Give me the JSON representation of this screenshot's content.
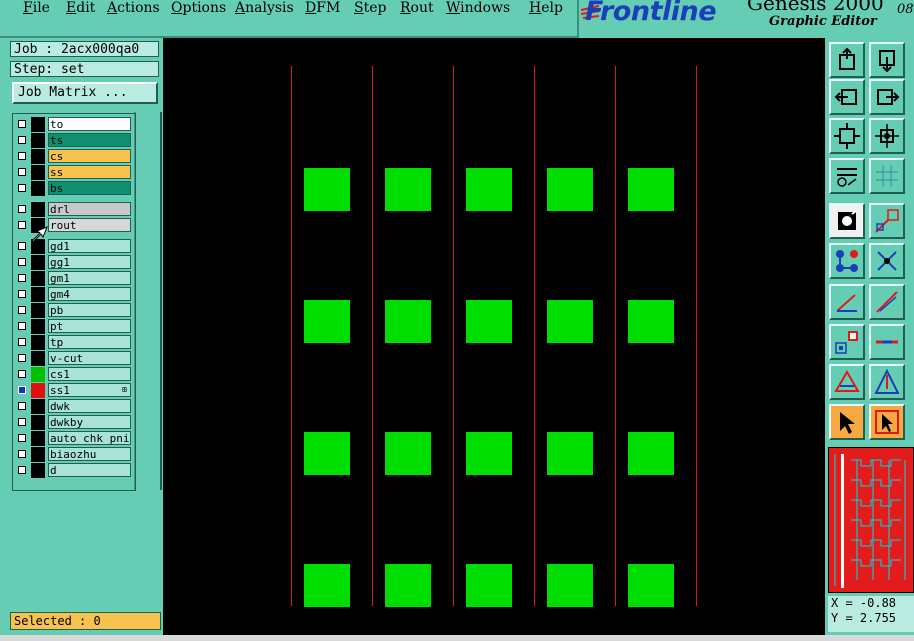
{
  "menubar": {
    "items": [
      "File",
      "Edit",
      "Actions",
      "Options",
      "Analysis",
      "DFM",
      "Step",
      "Rout",
      "Windows",
      "Help"
    ]
  },
  "brand": {
    "logo": "Frontline",
    "product": "Genesis 2000",
    "subtitle": "Graphic Editor",
    "extra": "08"
  },
  "job": {
    "job_label": "Job : 2acx000qa0",
    "step_label": "Step: set",
    "matrix_button": "Job Matrix ..."
  },
  "layers": [
    {
      "name": "to",
      "bg": "#ffffff",
      "swatch": "#000000"
    },
    {
      "name": "ts",
      "bg": "#0f8f6f",
      "swatch": "#000000"
    },
    {
      "name": "cs",
      "bg": "#f7c24d",
      "swatch": "#000000"
    },
    {
      "name": "ss",
      "bg": "#f7c24d",
      "swatch": "#000000"
    },
    {
      "name": "bs",
      "bg": "#0f8f6f",
      "swatch": "#000000"
    },
    {
      "name": "drl",
      "bg": "#c8c8c8",
      "swatch": "#000000"
    },
    {
      "name": "rout",
      "bg": "#d8d8d8",
      "swatch": "#000000"
    },
    {
      "name": "gd1",
      "bg": "#a8e3d6",
      "swatch": "#000000"
    },
    {
      "name": "gg1",
      "bg": "#a8e3d6",
      "swatch": "#000000"
    },
    {
      "name": "gm1",
      "bg": "#a8e3d6",
      "swatch": "#000000"
    },
    {
      "name": "gm4",
      "bg": "#a8e3d6",
      "swatch": "#000000"
    },
    {
      "name": "pb",
      "bg": "#a8e3d6",
      "swatch": "#000000"
    },
    {
      "name": "pt",
      "bg": "#a8e3d6",
      "swatch": "#000000"
    },
    {
      "name": "tp",
      "bg": "#a8e3d6",
      "swatch": "#000000"
    },
    {
      "name": "v-cut",
      "bg": "#a8e3d6",
      "swatch": "#000000"
    },
    {
      "name": "cs1",
      "bg": "#a8e3d6",
      "swatch": "#00c000"
    },
    {
      "name": "ss1",
      "bg": "#a8e3d6",
      "swatch": "#e01010",
      "active": true
    },
    {
      "name": "dwk",
      "bg": "#a8e3d6",
      "swatch": "#000000"
    },
    {
      "name": "dwkby",
      "bg": "#a8e3d6",
      "swatch": "#000000"
    },
    {
      "name": "auto_chk_pni",
      "bg": "#a8e3d6",
      "swatch": "#000000"
    },
    {
      "name": "biaozhu",
      "bg": "#a8e3d6",
      "swatch": "#000000"
    },
    {
      "name": "d",
      "bg": "#a8e3d6",
      "swatch": "#000000"
    }
  ],
  "status": {
    "selected": "Selected : 0"
  },
  "coords": {
    "x": "X = -0.88",
    "y": "Y = 2.755"
  },
  "colors": {
    "panel": "#66cdb5",
    "canvas": "#000000",
    "pad": "#00dd00",
    "rout_line": "#d01a1a"
  },
  "toolbar_icons": [
    "zoom-in-icon",
    "zoom-out-icon",
    "pan-left-icon",
    "pan-right-icon",
    "fit-icon",
    "center-icon",
    "measure-icon",
    "grid-icon",
    "feature-select-icon",
    "snap-icon",
    "net-icon",
    "cross-icon",
    "line-add-icon",
    "line-edit-icon",
    "pad-add-icon",
    "line-cut-icon",
    "triangle-icon",
    "arrow-triangle-icon",
    "pointer-icon",
    "pointer-box-icon"
  ]
}
